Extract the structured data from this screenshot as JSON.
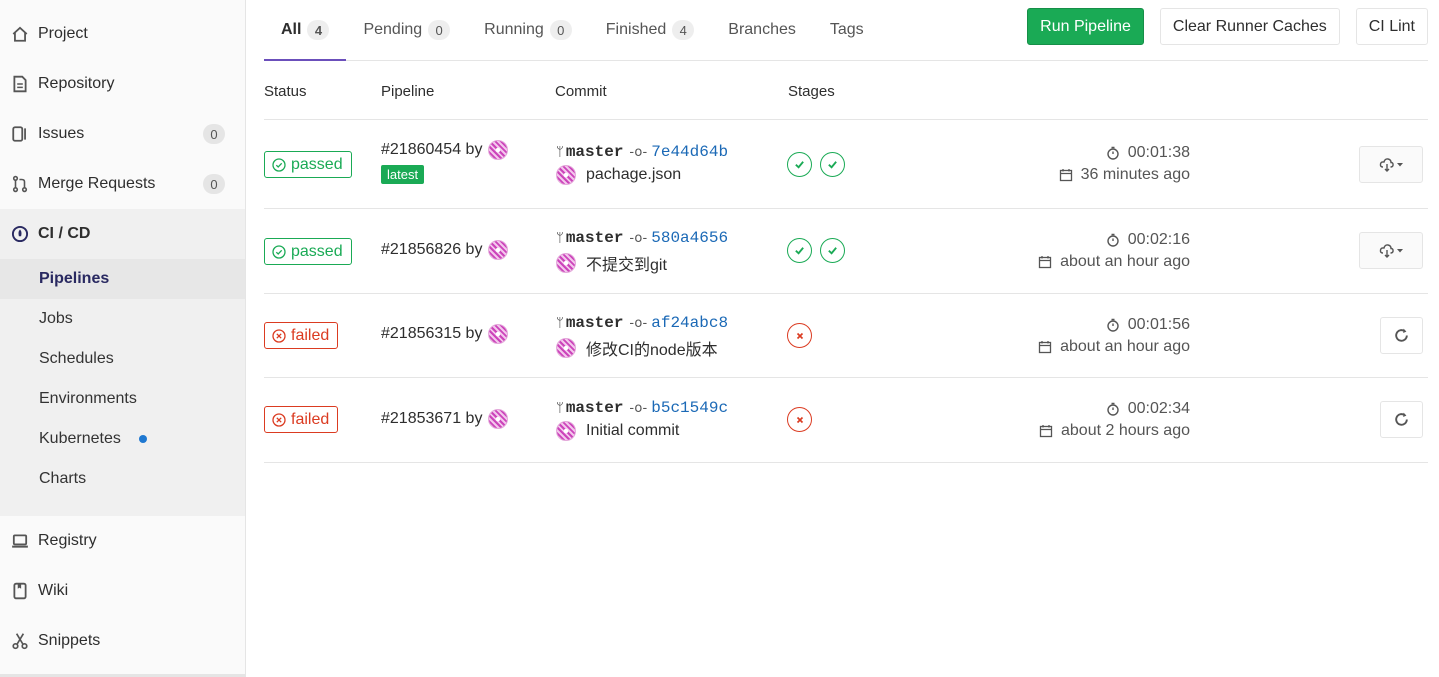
{
  "sidebar": {
    "items": [
      {
        "label": "Project",
        "icon": "home-icon"
      },
      {
        "label": "Repository",
        "icon": "doc-icon"
      },
      {
        "label": "Issues",
        "icon": "issues-icon",
        "badge": "0"
      },
      {
        "label": "Merge Requests",
        "icon": "merge-icon",
        "badge": "0"
      },
      {
        "label": "CI / CD",
        "icon": "rocket-icon",
        "active": true
      }
    ],
    "ci_sub": [
      {
        "label": "Pipelines",
        "current": true
      },
      {
        "label": "Jobs"
      },
      {
        "label": "Schedules"
      },
      {
        "label": "Environments"
      },
      {
        "label": "Kubernetes",
        "dot": true
      },
      {
        "label": "Charts"
      }
    ],
    "bottom_items": [
      {
        "label": "Registry",
        "icon": "registry-icon"
      },
      {
        "label": "Wiki",
        "icon": "book-icon"
      },
      {
        "label": "Snippets",
        "icon": "scissors-icon"
      }
    ]
  },
  "tabs": [
    {
      "label": "All",
      "count": "4",
      "active": true
    },
    {
      "label": "Pending",
      "count": "0"
    },
    {
      "label": "Running",
      "count": "0"
    },
    {
      "label": "Finished",
      "count": "4"
    },
    {
      "label": "Branches"
    },
    {
      "label": "Tags"
    }
  ],
  "actions": {
    "run": "Run Pipeline",
    "clear": "Clear Runner Caches",
    "lint": "CI Lint"
  },
  "table": {
    "headers": {
      "status": "Status",
      "pipeline": "Pipeline",
      "commit": "Commit",
      "stages": "Stages"
    },
    "rows": [
      {
        "status": "passed",
        "id": "#21860454",
        "by": "by",
        "latest": "latest",
        "branch": "master",
        "sha": "7e44d64b",
        "message": "pachage.json",
        "stages": [
          "ok",
          "ok"
        ],
        "duration": "00:01:38",
        "finished": "36 minutes ago",
        "action": "download"
      },
      {
        "status": "passed",
        "id": "#21856826",
        "by": "by",
        "branch": "master",
        "sha": "580a4656",
        "message": "不提交到git",
        "stages": [
          "ok",
          "ok"
        ],
        "duration": "00:02:16",
        "finished": "about an hour ago",
        "action": "download"
      },
      {
        "status": "failed",
        "id": "#21856315",
        "by": "by",
        "branch": "master",
        "sha": "af24abc8",
        "message": "修改CI的node版本",
        "stages": [
          "fail"
        ],
        "duration": "00:01:56",
        "finished": "about an hour ago",
        "action": "retry"
      },
      {
        "status": "failed",
        "id": "#21853671",
        "by": "by",
        "branch": "master",
        "sha": "b5c1549c",
        "message": "Initial commit",
        "stages": [
          "fail"
        ],
        "duration": "00:02:34",
        "finished": "about 2 hours ago",
        "action": "retry"
      }
    ]
  },
  "colors": {
    "success": "#1aaa55",
    "danger": "#db3b21",
    "link": "#1b69b6",
    "tab_underline": "#6b4fbb"
  }
}
